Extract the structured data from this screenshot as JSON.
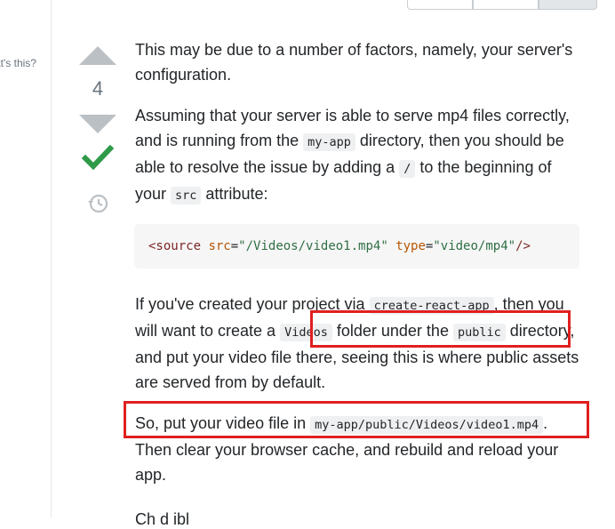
{
  "sidebar": {
    "whats_this": "at's this?"
  },
  "vote": {
    "score": "4",
    "up_label": "Up vote",
    "down_label": "Down vote"
  },
  "answer": {
    "p1": "This may be due to a number of factors, namely, your server's configuration.",
    "p2": {
      "t1": "Assuming that your server is able to serve mp4 files correctly, and is running from the ",
      "c1": "my-app",
      "t2": " directory, then you should be able to resolve the issue by adding a ",
      "c2": "/",
      "t3": " to the beginning of your ",
      "c3": "src",
      "t4": " attribute:"
    },
    "code_block": {
      "open": "<source ",
      "attr1": "src",
      "eq1": "=",
      "val1": "\"/Videos/video1.mp4\"",
      "space": " ",
      "attr2": "type",
      "eq2": "=",
      "val2": "\"video/mp4\"",
      "close": "/>"
    },
    "p3": {
      "t1": "If you've created your project via ",
      "c1": "create-react-app",
      "t2": ", then you will want to create a ",
      "c2": "Videos",
      "t3": " folder under the ",
      "c3": "public",
      "t4": " directory, and put your video file there, seeing this is where public assets are served from by default."
    },
    "p4": {
      "t1": "So, put your video file in ",
      "c1": "my-app/public/Videos/video1.mp4",
      "t2": ". Then clear your browser cache, and rebuild and reload your app."
    },
    "p5_partial": "Ch   d   ibl"
  },
  "colors": {
    "highlight": "#e0201f",
    "accepted": "#2f9a48",
    "vote_arrow": "#bbc0c4"
  }
}
